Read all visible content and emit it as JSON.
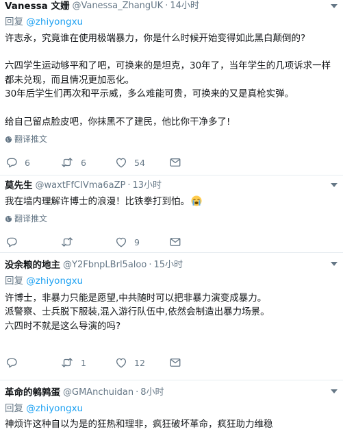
{
  "tweets": [
    {
      "name": "Vanessa 文姗",
      "handle": "@Vanessa_ZhangUK",
      "time": "14小时",
      "reply_prefix": "回复",
      "reply_to": "@zhiyongxu",
      "lines": [
        "许志永，究竟谁在使用极端暴力，你是什么时候开始变得如此黑白颠倒的?",
        "六四学生运动够平和了吧，可换来的是坦克，30年了，当年学生的几项诉求一样都未兑现，而且情况更加恶化。",
        "30年后学生们再次和平示威，多么难能可贵，可换来的又是真枪实弹。",
        "给自己留点脸皮吧，你抹黑不了建民，他比你干净多了!"
      ],
      "translate": "翻译推文",
      "replies": "6",
      "retweets": "6",
      "likes": "54"
    },
    {
      "name": "莫先生",
      "handle": "@waxtFfCIVma6aZP",
      "time": "13小时",
      "text": "我在墙内理解许博士的浪漫！比铁拳打到怕。",
      "emoji": "loudly-crying-face",
      "translate": "翻译推文",
      "replies": "",
      "retweets": "",
      "likes": "9"
    },
    {
      "name": "没余粮的地主",
      "handle": "@Y2FbnpLBrl5aloo",
      "time": "15小时",
      "reply_prefix": "回复",
      "reply_to": "@zhiyongxu",
      "lines": [
        "许博士，非暴力只能是愿望,中共随时可以把非暴力演变成暴力。",
        "派警察、士兵脱下服装,混入游行队伍中,依然会制造出暴力场景。",
        "六四时不就是这么导演的吗?"
      ],
      "replies": "",
      "retweets": "1",
      "likes": "12"
    },
    {
      "name": "革命的鹌鹑蛋",
      "handle": "@GMAnchuidan",
      "time": "8小时",
      "reply_prefix": "回复",
      "reply_to": "@zhiyongxu",
      "text": "神烦许这种自以为是的狂热和理非，疯狂破坏革命，疯狂助力维稳"
    }
  ],
  "colors": {
    "text": "#14171a",
    "muted": "#657786",
    "link": "#1da1f2",
    "divider": "#e6ecf0",
    "icon": "#657786"
  }
}
